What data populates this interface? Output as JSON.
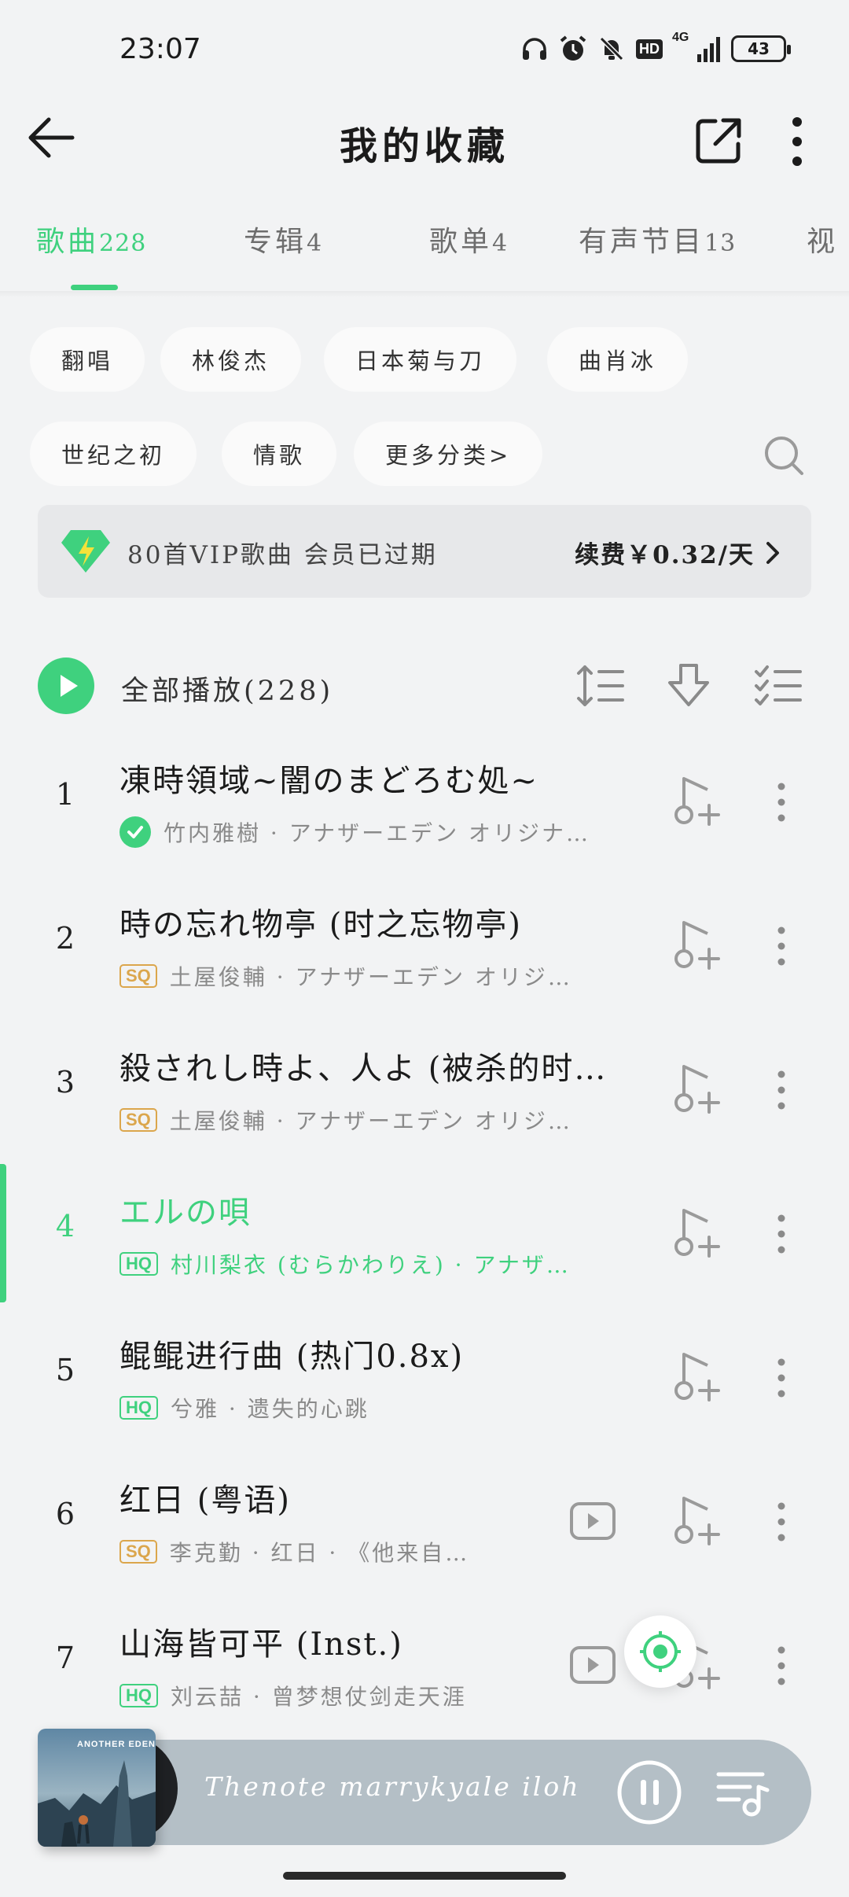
{
  "status_bar": {
    "time": "23:07",
    "network": "4G",
    "hd_label": "HD",
    "battery": "43",
    "icons": [
      "headphones-icon",
      "alarm-icon",
      "bell-mute-icon",
      "hd-icon",
      "signal-icon",
      "battery-icon"
    ]
  },
  "header": {
    "title": "我的收藏"
  },
  "tabs": [
    {
      "label": "歌曲",
      "count": "228",
      "active": true
    },
    {
      "label": "专辑",
      "count": "4",
      "active": false
    },
    {
      "label": "歌单",
      "count": "4",
      "active": false
    },
    {
      "label": "有声节目",
      "count": "13",
      "active": false
    },
    {
      "label": "视",
      "count": "",
      "active": false
    }
  ],
  "chips": [
    "翻唱",
    "林俊杰",
    "日本菊与刀",
    "曲肖冰",
    "世纪之初",
    "情歌",
    "更多分类>"
  ],
  "vip_banner": {
    "text": "80首VIP歌曲 会员已过期",
    "renew": "续费￥0.32/天"
  },
  "play_all": {
    "label": "全部播放(228)"
  },
  "songs": [
    {
      "index": "1",
      "title": "凍時領域~闇のまどろむ処~",
      "badge": "check",
      "subtitle": "竹内雅樹 · アナザーエデン オリジナ…",
      "mv": false
    },
    {
      "index": "2",
      "title": "時の忘れ物亭 (时之忘物亭)",
      "badge": "SQ",
      "subtitle": "土屋俊輔 · アナザーエデン オリジ…",
      "mv": false
    },
    {
      "index": "3",
      "title": "殺されし時よ、人よ (被杀的时…",
      "badge": "SQ",
      "subtitle": "土屋俊輔 · アナザーエデン オリジ…",
      "mv": false
    },
    {
      "index": "4",
      "title": "エルの唄",
      "badge": "HQ",
      "subtitle": "村川梨衣 (むらかわりえ) · アナザ…",
      "mv": false,
      "playing": true
    },
    {
      "index": "5",
      "title": "鲲鲲进行曲 (热门0.8x)",
      "badge": "HQ",
      "subtitle": "兮雅 · 遗失的心跳",
      "mv": false
    },
    {
      "index": "6",
      "title": "红日 (粤语)",
      "badge": "SQ",
      "subtitle": "李克勤 · 红日 · 《他来自…",
      "mv": true
    },
    {
      "index": "7",
      "title": "山海皆可平 (Inst.)",
      "badge": "HQ",
      "subtitle": "刘云喆 · 曾梦想仗剑走天涯",
      "mv": true
    }
  ],
  "player": {
    "album_label": "ANOTHER EDEN",
    "lyric": "Thenote marrykyale iloh"
  },
  "colors": {
    "accent": "#3fd17e",
    "sq_badge": "#dba64c",
    "background": "#f2f3f4",
    "player_bg": "#b4bfc6"
  }
}
